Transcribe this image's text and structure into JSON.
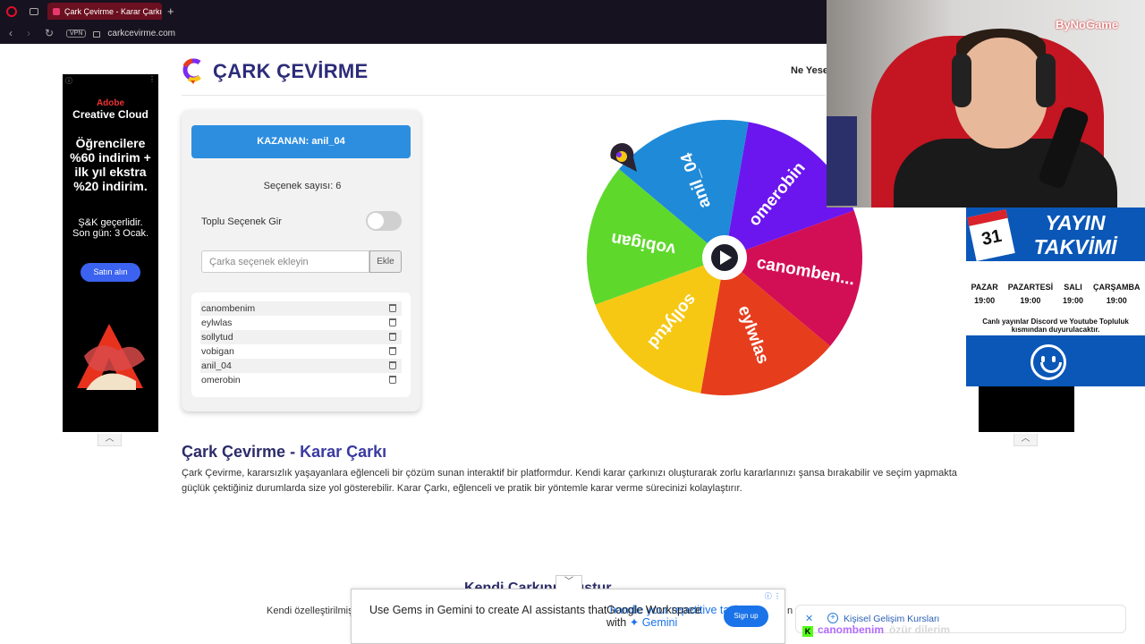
{
  "browser": {
    "tab_title": "Çark Çevirme - Karar Çarkı",
    "url": "carkcevirme.com",
    "vpn_label": "VPN"
  },
  "header": {
    "site_title": "ÇARK ÇEVİRME",
    "nav_link": "Ne Yeser"
  },
  "panel": {
    "winner_label": "KAZANAN: anil_04",
    "count_label": "Seçenek sayısı:",
    "count_value": "6",
    "bulk_label": "Toplu Seçenek Gir",
    "input_placeholder": "Çarka seçenek ekleyin",
    "add_label": "Ekle",
    "options": [
      "canombenim",
      "eylwlas",
      "sollytud",
      "vobigan",
      "anil_04",
      "omerobin"
    ]
  },
  "wheel": {
    "segments": [
      {
        "label": "omerobin",
        "color": "#6b16ee"
      },
      {
        "label": "canomben...",
        "color": "#d20f55"
      },
      {
        "label": "eylwlas",
        "color": "#e63d1d"
      },
      {
        "label": "sollytud",
        "color": "#f6c814"
      },
      {
        "label": "vobigan",
        "color": "#5fd82c"
      },
      {
        "label": "anil_04",
        "color": "#1f8ad8"
      }
    ]
  },
  "article": {
    "heading_main": "Çark Çevirme -",
    "heading_accent": "Karar Çarkı",
    "body": "Çark Çevirme, kararsızlık yaşayanlara eğlenceli bir çözüm sunan interaktif bir platformdur. Kendi karar çarkınızı oluşturarak zorlu kararlarınızı şansa bırakabilir ve seçim yapmakta güçlük çektiğiniz durumlarda size yol gösterebilir. Karar Çarkı, eğlenceli ve pratik bir yöntemle karar verme sürecinizi kolaylaştırır.",
    "sub_heading": "Kendi Çarkını Oluştur",
    "sub_text_left": "Kendi özelleştirilmiş",
    "sub_text_right": "n y"
  },
  "ad_left": {
    "brand_line1": "Adobe",
    "brand_line2": "Creative Cloud",
    "headline": "Öğrencilere %60 indirim + ilk yıl ekstra %20 indirim.",
    "fine_print": "Ş&K geçerlidir. Son gün: 3 Ocak.",
    "cta": "Satın alın"
  },
  "ad_bottom": {
    "text_plain": "Use Gems in Gemini to create AI assistants that",
    "text_highlight": "handle your repetitive tasks.",
    "brand_line1": "Google Workspace",
    "brand_line2_prefix": "with",
    "brand_line2_name": "Gemini",
    "cta": "Sign up"
  },
  "notification": {
    "text": "Kişisel Gelişim Kursları"
  },
  "chat_overlay": {
    "user": "canombenim",
    "message": "özür dilerim"
  },
  "stream": {
    "brand": "ByNoGame",
    "schedule_title": "YAYIN TAKVİMİ",
    "calendar_day": "31",
    "days": [
      {
        "day": "PAZAR",
        "time": "19:00"
      },
      {
        "day": "PAZARTESİ",
        "time": "19:00"
      },
      {
        "day": "SALI",
        "time": "19:00"
      },
      {
        "day": "ÇARŞAMBA",
        "time": "19:00"
      }
    ],
    "note": "Canlı yayınlar Discord ve Youtube Topluluk kısmından duyurulacaktır."
  }
}
